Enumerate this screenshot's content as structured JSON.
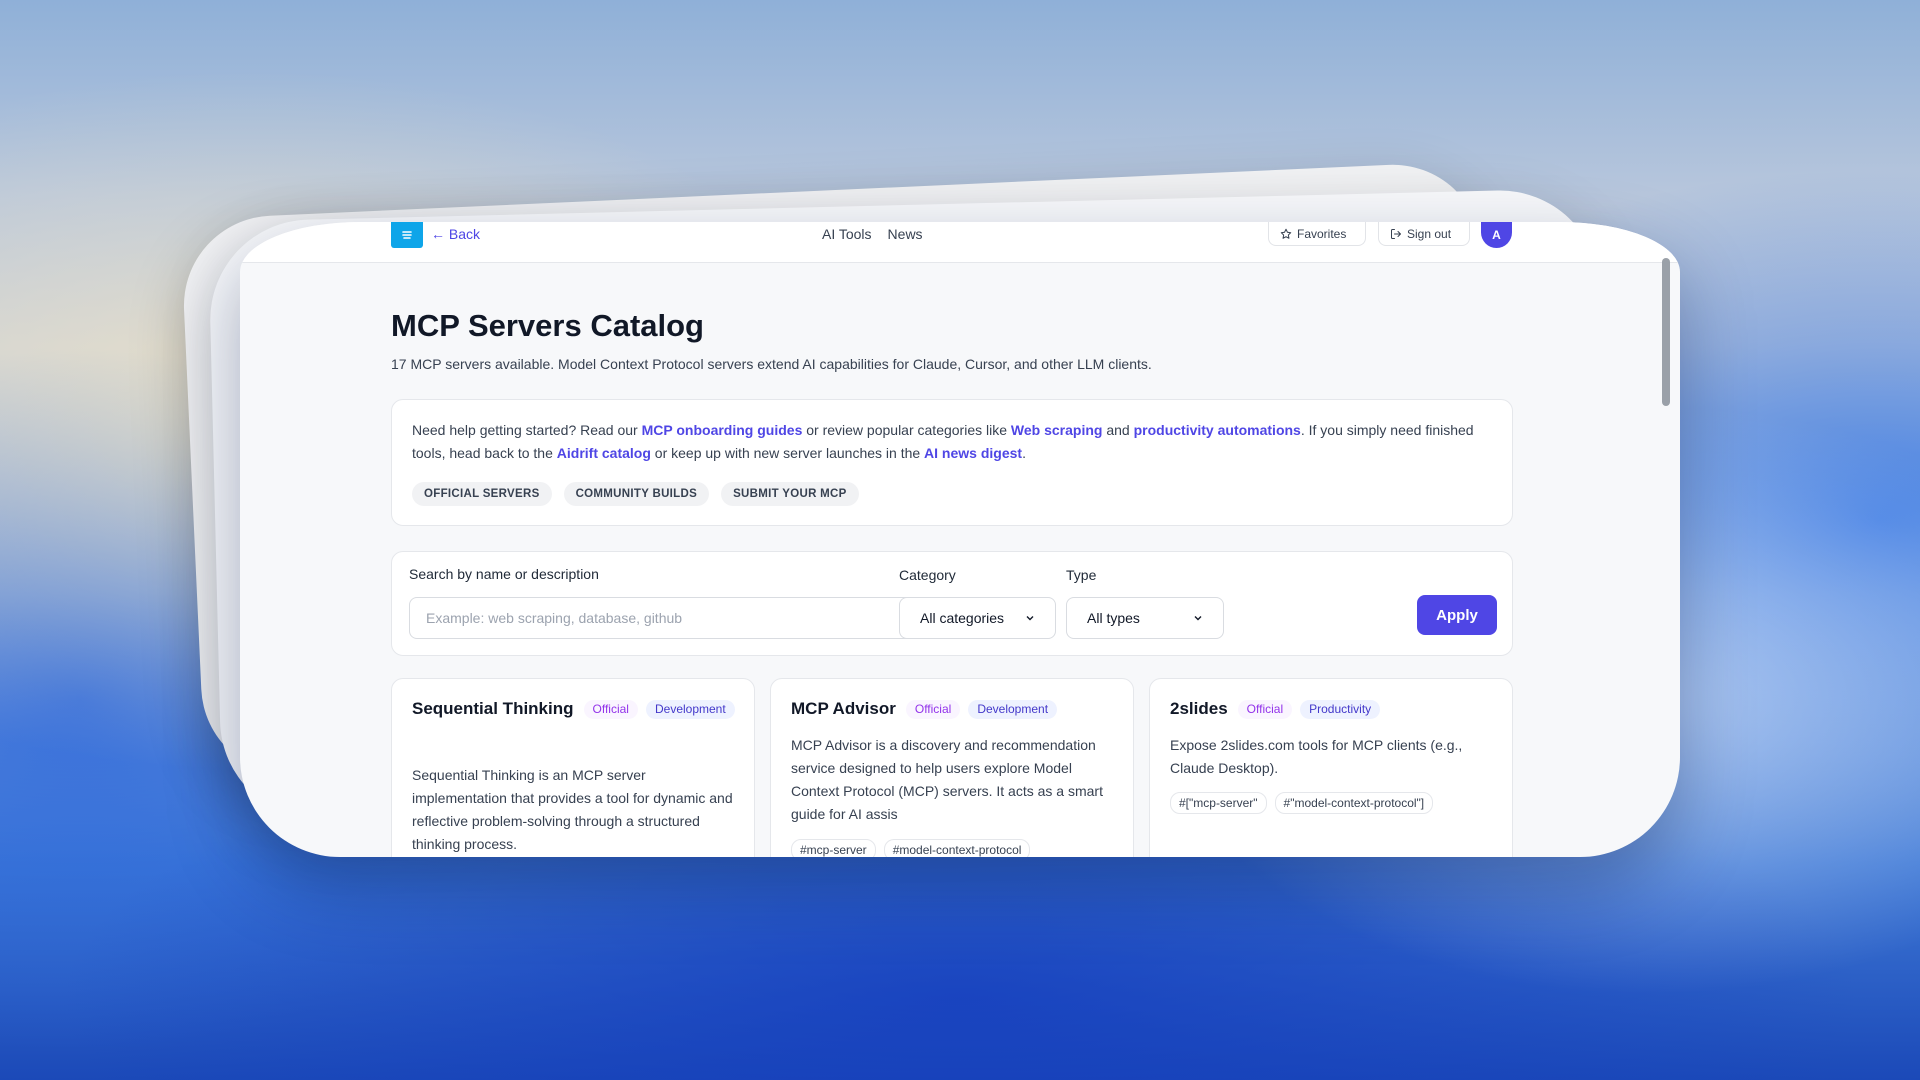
{
  "topbar": {
    "back_label": "← Back",
    "nav": [
      "AI Tools",
      "News"
    ],
    "favorites_label": "Favorites",
    "signout_label": "Sign out",
    "avatar_initial": "A"
  },
  "page": {
    "title": "MCP Servers Catalog",
    "subtitle": "17 MCP servers available. Model Context Protocol servers extend AI capabilities for Claude, Cursor, and other LLM clients."
  },
  "help": {
    "t1": "Need help getting started? Read our ",
    "link_onboarding": "MCP onboarding guides",
    "t2": " or review popular categories like ",
    "link_scraping": "Web scraping",
    "t3": " and ",
    "link_productivity": "productivity automations",
    "t4": ". If you simply need finished tools, head back to the ",
    "link_catalog": "Aidrift catalog",
    "t5": " or keep up with new server launches in the ",
    "link_news": "AI news digest",
    "t6": ".",
    "chips": [
      "OFFICIAL SERVERS",
      "COMMUNITY BUILDS",
      "SUBMIT YOUR MCP"
    ]
  },
  "filters": {
    "search_label": "Search by name or description",
    "search_placeholder": "Example: web scraping, database, github",
    "search_value": "",
    "category_label": "Category",
    "category_value": "All categories",
    "type_label": "Type",
    "type_value": "All types",
    "apply_label": "Apply"
  },
  "cards": [
    {
      "title": "Sequential Thinking",
      "official": "Official",
      "category": "Development",
      "description": "Sequential Thinking is an MCP server implementation that provides a tool for dynamic and reflective problem-solving through a structured thinking process.",
      "tags": []
    },
    {
      "title": "MCP Advisor",
      "official": "Official",
      "category": "Development",
      "description": "MCP Advisor is a discovery and recommendation service designed to help users explore Model Context Protocol (MCP) servers. It acts as a smart guide for AI assis",
      "tags": [
        "#mcp-server",
        "#model-context-protocol"
      ]
    },
    {
      "title": "2slides",
      "official": "Official",
      "category": "Productivity",
      "description": "Expose 2slides.com tools for MCP clients (e.g., Claude Desktop).",
      "tags": [
        "#[\"mcp-server\"",
        "#\"model-context-protocol\"]"
      ]
    }
  ]
}
